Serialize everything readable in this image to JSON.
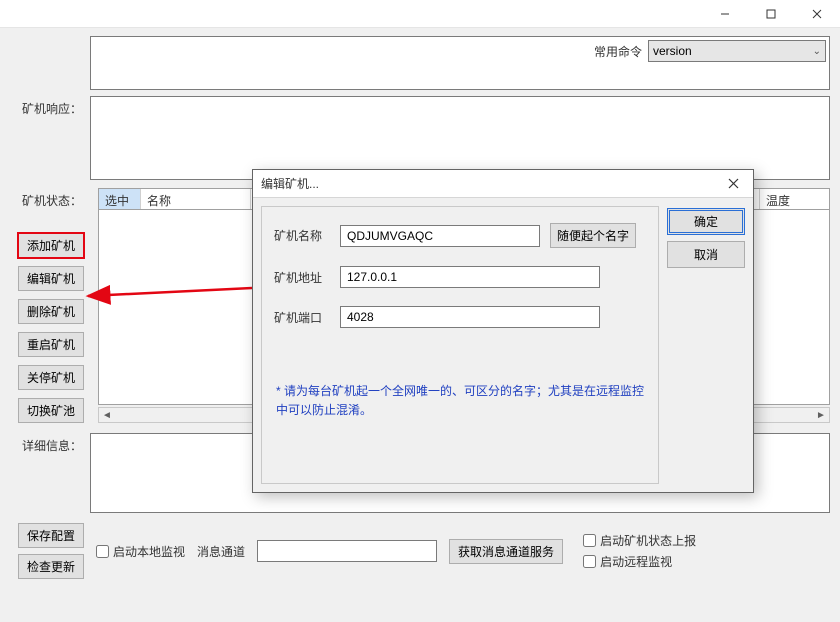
{
  "window": {
    "titlebar": {
      "min": "min",
      "max": "max",
      "close": "close"
    }
  },
  "top": {
    "cmd_label": "常用命令",
    "cmd_value": "version"
  },
  "labels": {
    "response": "矿机响应：",
    "status": "矿机状态：",
    "detail": "详细信息："
  },
  "table": {
    "col_select": "选中",
    "col_name": "名称",
    "col_temp": "温度"
  },
  "side_buttons": {
    "add": "添加矿机",
    "edit": "编辑矿机",
    "delete": "删除矿机",
    "restart": "重启矿机",
    "shutdown": "关停矿机",
    "switch": "切换矿池"
  },
  "bottom": {
    "save": "保存配置",
    "check": "检查更新",
    "local_watch": "启动本地监视",
    "msg_channel_label": "消息通道",
    "get_msg_service": "获取消息通道服务",
    "status_report": "启动矿机状态上报",
    "remote_watch": "启动远程监视"
  },
  "dialog": {
    "title": "编辑矿机...",
    "name_label": "矿机名称",
    "name_value": "QDJUMVGAQC",
    "random_name": "随便起个名字",
    "addr_label": "矿机地址",
    "addr_value": "127.0.0.1",
    "port_label": "矿机端口",
    "port_value": "4028",
    "note": "* 请为每台矿机起一个全网唯一的、可区分的名字；尤其是在远程监控中可以防止混淆。",
    "ok": "确定",
    "cancel": "取消"
  }
}
